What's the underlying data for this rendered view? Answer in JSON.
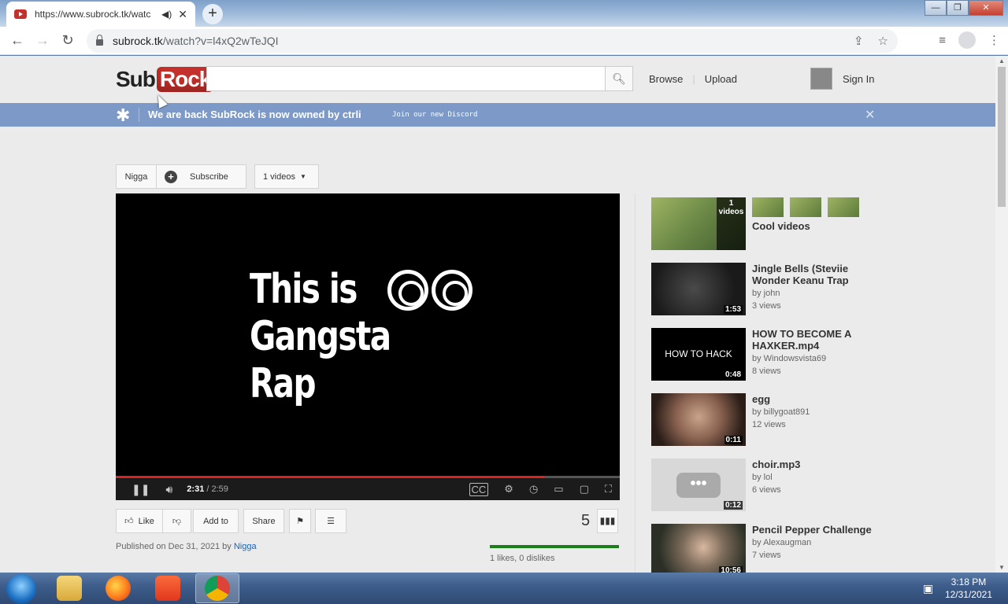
{
  "browser": {
    "tab_title": "https://www.subrock.tk/watc",
    "new_tab": "+",
    "url_host": "subrock.tk",
    "url_path": "/watch?v=l4xQ2wTeJQI",
    "window_controls": [
      "—",
      "❐",
      "✕"
    ]
  },
  "site": {
    "logo_sub": "Sub",
    "logo_rock": "Rock",
    "search_placeholder": "",
    "browse": "Browse",
    "upload": "Upload",
    "sign_in": "Sign In"
  },
  "banner": {
    "text": "We are back SubRock is now owned by ctrli",
    "link": "Join our new Discord",
    "close": "✕"
  },
  "channel": {
    "name": "Nigga",
    "subscribe": "Subscribe",
    "videos": "1 videos"
  },
  "player": {
    "line1": "This is",
    "line2": "Gangsta Rap",
    "current_time": "2:31",
    "duration": "/ 2:59",
    "progress": 0.85
  },
  "actions": {
    "like": "Like",
    "add_to": "Add to",
    "share": "Share",
    "view_count": "5",
    "published_prefix": "Published on Dec 31, 2021 by",
    "published_by": "Nigga",
    "likes_text": "1 likes, 0 dislikes"
  },
  "sidebar": {
    "playlist": {
      "title": "Cool videos",
      "count": "1",
      "count_label": "videos"
    },
    "items": [
      {
        "title": "Jingle Bells (Steviie Wonder Keanu Trap",
        "by": "by john",
        "views": "3 views",
        "duration": "1:53"
      },
      {
        "title": "HOW TO BECOME A HAXKER.mp4",
        "by": "by Windowsvista69",
        "views": "8 views",
        "duration": "0:48",
        "thumb_text": "HOW TO HACK"
      },
      {
        "title": "egg",
        "by": "by billygoat891",
        "views": "12 views",
        "duration": "0:11"
      },
      {
        "title": "choir.mp3",
        "by": "by lol",
        "views": "6 views",
        "duration": "0:12"
      },
      {
        "title": "Pencil Pepper Challenge",
        "by": "by Alexaugman",
        "views": "7 views",
        "duration": "10:56"
      }
    ]
  },
  "taskbar": {
    "time": "3:18 PM",
    "date": "12/31/2021"
  }
}
